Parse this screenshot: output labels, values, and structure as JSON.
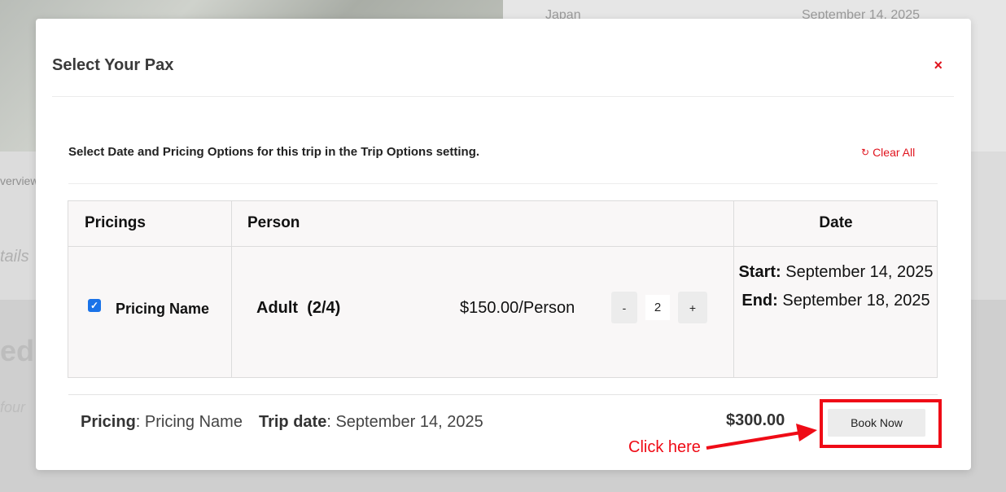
{
  "background": {
    "country": "Japan",
    "date": "September 14, 2025",
    "overview": "verview",
    "details": "tails",
    "heading_fragment": "ed",
    "text_fragment": "four"
  },
  "modal": {
    "title": "Select Your Pax",
    "close_symbol": "×",
    "instruction": "Select Date and Pricing Options for this trip in the Trip Options setting.",
    "clear_all": {
      "icon": "refresh-icon",
      "label": "Clear All"
    }
  },
  "table": {
    "headers": {
      "pricings": "Pricings",
      "person": "Person",
      "date": "Date"
    },
    "row": {
      "checked": true,
      "pricing_name": "Pricing Name",
      "person_type": "Adult  (2/4)",
      "price": "$150.00/Person",
      "minus": "-",
      "quantity": "2",
      "plus": "+",
      "start_label": "Start:",
      "start_date": "September 14, 2025",
      "end_label": "End:",
      "end_date": "September 18, 2025"
    }
  },
  "footer": {
    "pricing_label": "Pricing",
    "pricing_value": "Pricing Name",
    "trip_date_label": "Trip date",
    "trip_date_value": "September 14, 2025",
    "total": "$300.00",
    "book_now": "Book Now"
  },
  "annotation": {
    "text": "Click here",
    "color": "#ef0b16"
  },
  "colors": {
    "accent_red": "#e0141e",
    "checkbox_blue": "#1a73e8",
    "table_bg": "#f9f7f7"
  }
}
